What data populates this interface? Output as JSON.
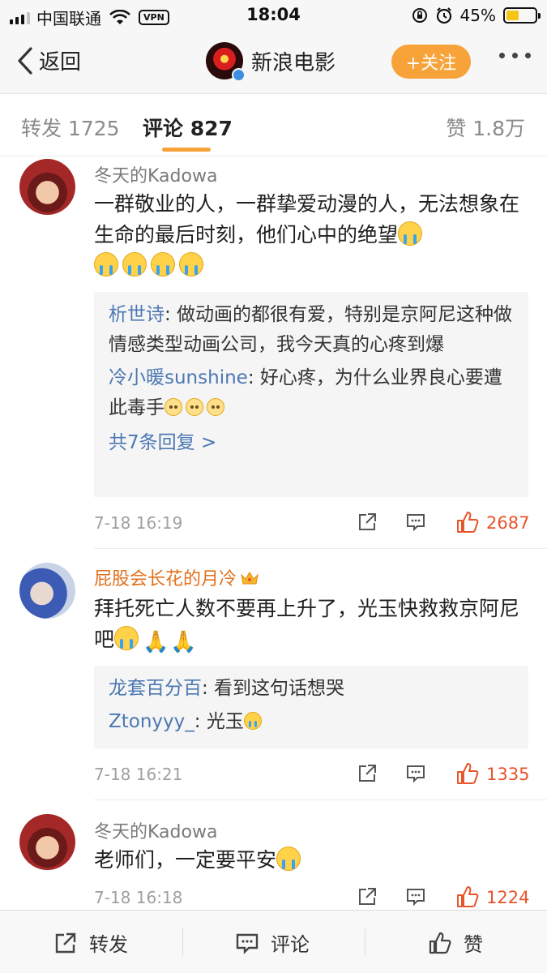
{
  "status_bar": {
    "carrier": "中国联通",
    "vpn": "VPN",
    "time": "18:04",
    "battery": "45%",
    "battery_level": 0.45
  },
  "nav": {
    "back_label": "返回",
    "title": "新浪电影",
    "follow_label": "+关注"
  },
  "tabs": {
    "repost": "转发 1725",
    "comments": "评论 827",
    "likes": "赞 1.8万"
  },
  "comments": [
    {
      "user": "冬天的Kadowa",
      "text": "一群敬业的人，一群挚爱动漫的人，无法想象在生命的最后时刻，他们心中的绝望",
      "replies": [
        {
          "user": "析世诗",
          "text": ": 做动画的都很有爱，特别是京阿尼这种做情感类型动画公司，我今天真的心疼到爆"
        },
        {
          "user": "冷小暖sunshine",
          "text": ": 好心疼，为什么业界良心要遭此毒手"
        }
      ],
      "more_replies": "共7条回复 >",
      "time": "7-18 16:19",
      "likes": "2687"
    },
    {
      "user": "屁股会长花的月冷",
      "text": "拜托死亡人数不要再上升了，光玉快救救京阿尼吧",
      "replies": [
        {
          "user": "龙套百分百",
          "text": ": 看到这句话想哭"
        },
        {
          "user": "Ztonyyy_",
          "text": ": 光玉"
        }
      ],
      "time": "7-18 16:21",
      "likes": "1335"
    },
    {
      "user": "冬天的Kadowa",
      "text": "老师们，一定要平安",
      "time": "7-18 16:18",
      "likes": "1224"
    }
  ],
  "bottom_bar": {
    "repost": "转发",
    "comment": "评论",
    "like": "赞"
  },
  "colors": {
    "accent": "#f7a33a",
    "link": "#4c78b2",
    "like": "#e8542b",
    "vip_name": "#e2701b"
  }
}
